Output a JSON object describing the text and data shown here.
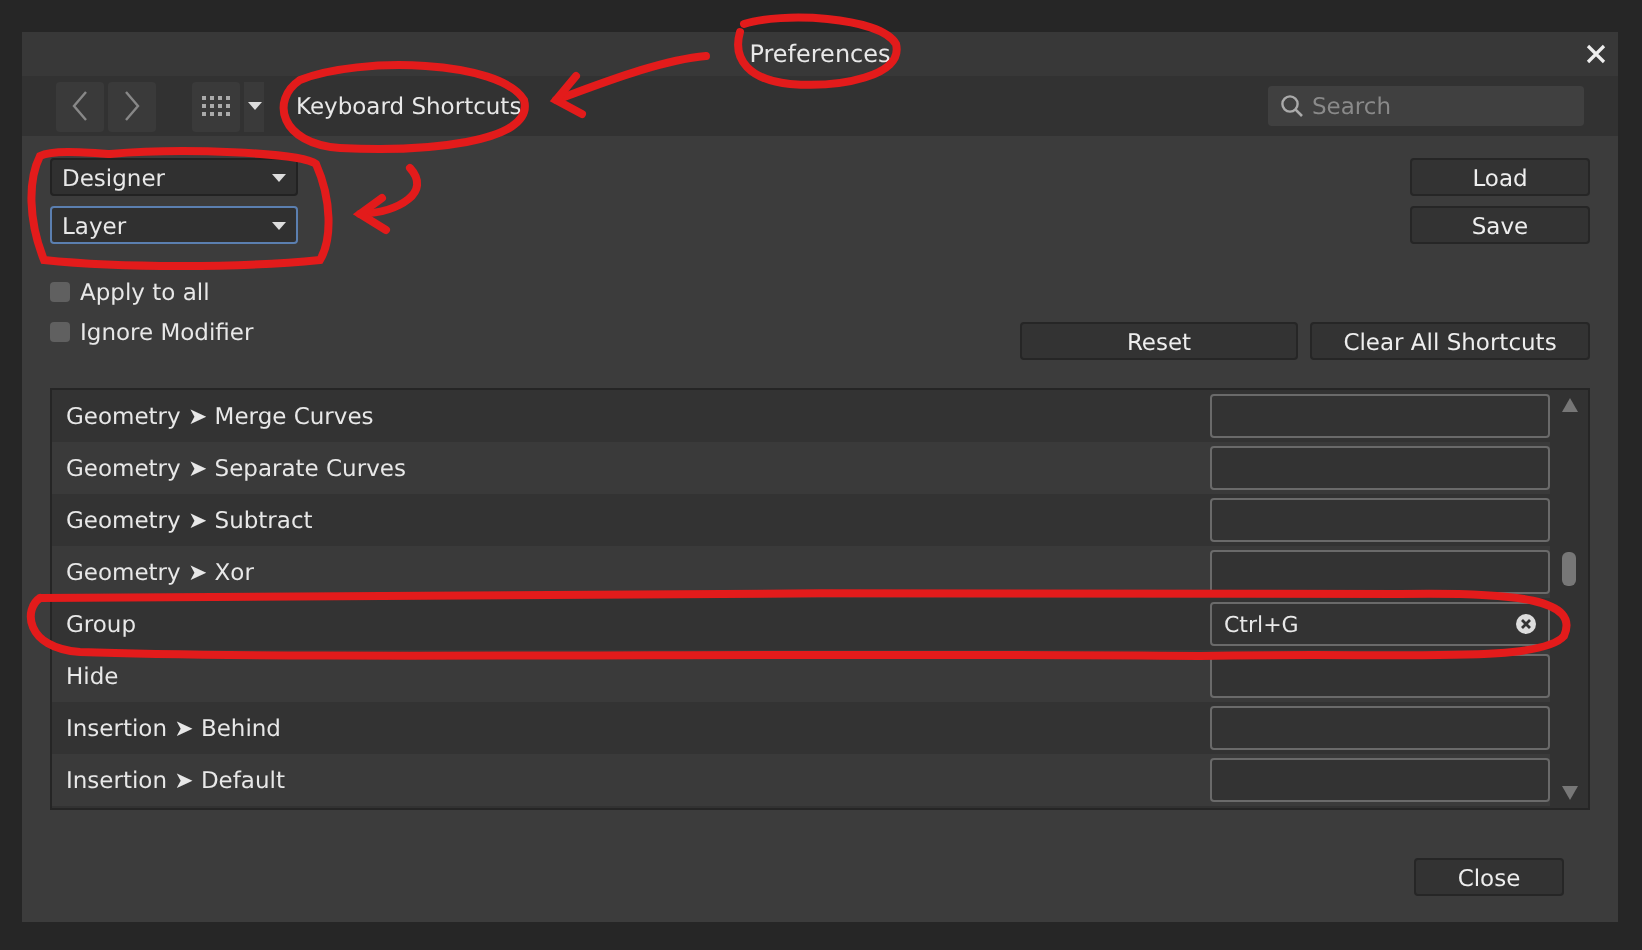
{
  "window": {
    "title": "Preferences"
  },
  "toolbar": {
    "section": "Keyboard Shortcuts",
    "search": {
      "placeholder": "Search"
    }
  },
  "dropdowns": [
    {
      "value": "Designer",
      "focused": false
    },
    {
      "value": "Layer",
      "focused": true
    }
  ],
  "side_buttons": [
    "Load",
    "Save"
  ],
  "checkboxes": [
    {
      "label": "Apply to all",
      "checked": false
    },
    {
      "label": "Ignore Modifier",
      "checked": false
    }
  ],
  "action_buttons": [
    "Reset",
    "Clear All Shortcuts"
  ],
  "shortcuts": [
    {
      "command": "Geometry ➤ Merge Curves"
    },
    {
      "command": "Geometry ➤ Separate Curves"
    },
    {
      "command": "Geometry ➤ Subtract"
    },
    {
      "command": "Geometry ➤ Xor"
    },
    {
      "command": "Group",
      "shortcut": "Ctrl+G"
    },
    {
      "command": "Hide"
    },
    {
      "command": "Insertion ➤ Behind"
    },
    {
      "command": "Insertion ➤ Default"
    }
  ],
  "footer_button": "Close"
}
